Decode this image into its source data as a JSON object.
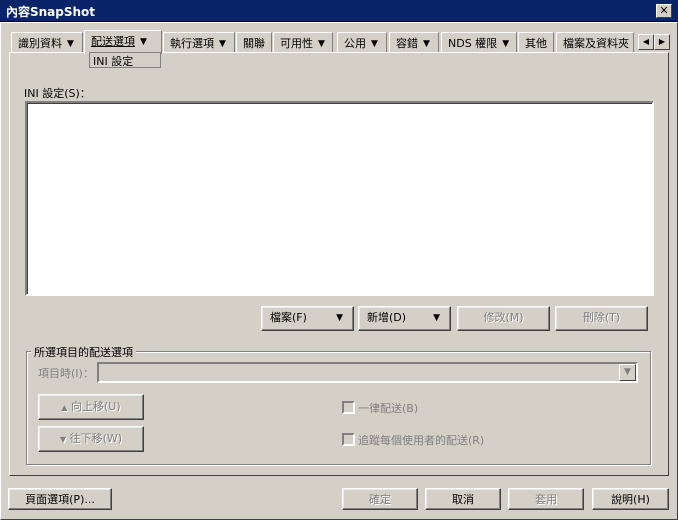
{
  "window": {
    "title": "內容SnapShot",
    "close_glyph": "✕"
  },
  "tabs": [
    {
      "label": "識別資料"
    },
    {
      "label": "配送選項"
    },
    {
      "label": "執行選項"
    },
    {
      "label": "關聯"
    },
    {
      "label": "可用性"
    },
    {
      "label": "公用"
    },
    {
      "label": "容錯"
    },
    {
      "label": "NDS 權限"
    },
    {
      "label": "其他"
    },
    {
      "label": "檔案及資料夾"
    }
  ],
  "tab_scroll": {
    "left": "◀",
    "right": "▶"
  },
  "subtab": {
    "label": "INI 設定"
  },
  "ini": {
    "label": "INI 設定(S)："
  },
  "actions": {
    "file": "檔案(F)",
    "add": "新增(D)",
    "modify": "修改(M)",
    "delete": "刪除(T)"
  },
  "group": {
    "title": "所選項目的配送選項",
    "item_label": "項目時(I)：",
    "item_value": "",
    "move_up": "向上移(U)",
    "move_down": "往下移(W)",
    "always_distribute": "一律配送(B)",
    "track_per_user": "追蹤每個使用者的配送(R)"
  },
  "footer": {
    "page_options": "頁面選項(P)...",
    "ok": "確定",
    "cancel": "取消",
    "apply": "套用",
    "help": "說明(H)"
  },
  "colors": {
    "titlebar": "#0a246a",
    "face": "#d4d0c8",
    "disabled_text": "#808080"
  }
}
